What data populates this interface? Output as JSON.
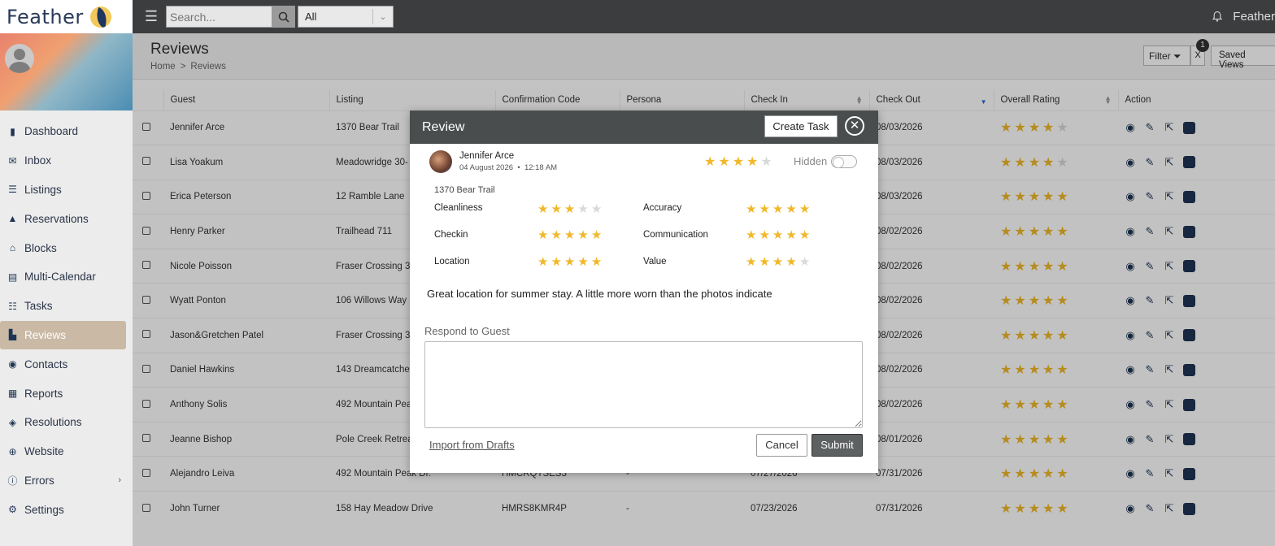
{
  "app": {
    "logo_text": "Feather",
    "user_name": "Feather"
  },
  "topbar": {
    "search_placeholder": "Search...",
    "select_value": "All"
  },
  "sidebar": {
    "items": [
      {
        "label": "Dashboard",
        "icon": "chart-icon"
      },
      {
        "label": "Inbox",
        "icon": "envelope-icon"
      },
      {
        "label": "Listings",
        "icon": "list-icon"
      },
      {
        "label": "Reservations",
        "icon": "bell-icon"
      },
      {
        "label": "Blocks",
        "icon": "block-icon"
      },
      {
        "label": "Multi-Calendar",
        "icon": "calendar-icon"
      },
      {
        "label": "Tasks",
        "icon": "tasks-icon"
      },
      {
        "label": "Reviews",
        "icon": "reviews-icon"
      },
      {
        "label": "Contacts",
        "icon": "contact-icon"
      },
      {
        "label": "Reports",
        "icon": "report-icon"
      },
      {
        "label": "Resolutions",
        "icon": "layers-icon"
      },
      {
        "label": "Website",
        "icon": "globe-icon"
      },
      {
        "label": "Errors",
        "icon": "error-icon"
      },
      {
        "label": "Settings",
        "icon": "gear-icon"
      }
    ],
    "active": "Reviews"
  },
  "page": {
    "title": "Reviews",
    "breadcrumb": [
      "Home",
      "Reviews"
    ],
    "filter_label": "Filter",
    "filter_clear": "X",
    "filter_count": "1",
    "saved_views_label": "Saved Views"
  },
  "table": {
    "headers": [
      "Guest",
      "Listing",
      "Confirmation Code",
      "Persona",
      "Check In",
      "Check Out",
      "Overall Rating",
      "Action"
    ],
    "rows": [
      {
        "guest": "Jennifer Arce",
        "listing": "1370 Bear Trail",
        "code": "",
        "persona": "",
        "check_in": "",
        "check_out": "08/03/2026",
        "rating": 4
      },
      {
        "guest": "Lisa Yoakum",
        "listing": "Meadowridge 30-",
        "code": "",
        "persona": "",
        "check_in": "",
        "check_out": "08/03/2026",
        "rating": 4
      },
      {
        "guest": "Erica Peterson",
        "listing": "12 Ramble Lane",
        "code": "",
        "persona": "",
        "check_in": "",
        "check_out": "08/03/2026",
        "rating": 5
      },
      {
        "guest": "Henry Parker",
        "listing": "Trailhead 711",
        "code": "",
        "persona": "",
        "check_in": "",
        "check_out": "08/02/2026",
        "rating": 5
      },
      {
        "guest": "Nicole Poisson",
        "listing": "Fraser Crossing 3",
        "code": "",
        "persona": "",
        "check_in": "",
        "check_out": "08/02/2026",
        "rating": 5
      },
      {
        "guest": "Wyatt Ponton",
        "listing": "106 Willows Way",
        "code": "",
        "persona": "",
        "check_in": "",
        "check_out": "08/02/2026",
        "rating": 5
      },
      {
        "guest": "Jason&Gretchen Patel",
        "listing": "Fraser Crossing 3",
        "code": "",
        "persona": "",
        "check_in": "",
        "check_out": "08/02/2026",
        "rating": 5
      },
      {
        "guest": "Daniel Hawkins",
        "listing": "143 Dreamcatche",
        "code": "",
        "persona": "",
        "check_in": "",
        "check_out": "08/02/2026",
        "rating": 5
      },
      {
        "guest": "Anthony Solis",
        "listing": "492 Mountain Pea",
        "code": "",
        "persona": "",
        "check_in": "",
        "check_out": "08/02/2026",
        "rating": 5
      },
      {
        "guest": "Jeanne Bishop",
        "listing": "Pole Creek Retrea",
        "code": "",
        "persona": "",
        "check_in": "",
        "check_out": "08/01/2026",
        "rating": 5
      },
      {
        "guest": "Alejandro Leiva",
        "listing": "492 Mountain Peak Dr.",
        "code": "HMCRQTSES3",
        "persona": "-",
        "check_in": "07/27/2026",
        "check_out": "07/31/2026",
        "rating": 5
      },
      {
        "guest": "John Turner",
        "listing": "158 Hay Meadow Drive",
        "code": "HMRS8KMR4P",
        "persona": "-",
        "check_in": "07/23/2026",
        "check_out": "07/31/2026",
        "rating": 5
      }
    ]
  },
  "modal": {
    "title": "Review",
    "create_task_label": "Create Task",
    "guest_name": "Jennifer Arce",
    "date": "04 August 2026",
    "time": "12:18 AM",
    "overall_rating": 4,
    "hidden_label": "Hidden",
    "listing": "1370 Bear Trail",
    "categories": [
      {
        "label": "Cleanliness",
        "rating": 3
      },
      {
        "label": "Accuracy",
        "rating": 5
      },
      {
        "label": "Checkin",
        "rating": 5
      },
      {
        "label": "Communication",
        "rating": 5
      },
      {
        "label": "Location",
        "rating": 5
      },
      {
        "label": "Value",
        "rating": 4
      }
    ],
    "review_text": "Great location for summer stay. A little more worn than the photos indicate",
    "respond_label": "Respond to Guest",
    "respond_value": "",
    "import_label": "Import from Drafts",
    "cancel_label": "Cancel",
    "submit_label": "Submit"
  },
  "colors": {
    "star_on": "#f0b82a",
    "star_off": "#d9d9d9",
    "topbar": "#3b3d3e",
    "active_nav": "#c9b9a5"
  }
}
